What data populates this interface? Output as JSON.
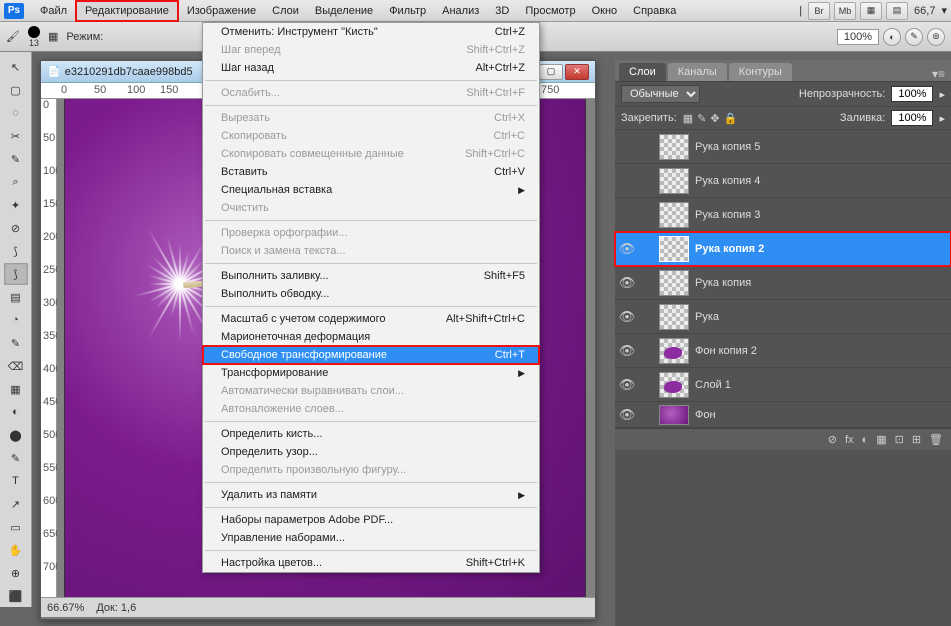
{
  "menubar": {
    "items": [
      "Файл",
      "Редактирование",
      "Изображение",
      "Слои",
      "Выделение",
      "Фильтр",
      "Анализ",
      "3D",
      "Просмотр",
      "Окно",
      "Справка"
    ],
    "highlight_index": 1,
    "right_buttons": [
      "Br",
      "Mb",
      "▦",
      "▤"
    ],
    "zoom_pct": "66,7"
  },
  "optbar": {
    "brush_size": "13",
    "mode_label": "Режим:",
    "zoom": "100%"
  },
  "document": {
    "title": "e3210291db7caae998bd5",
    "ruler_h": [
      "0",
      "50",
      "100",
      "150",
      "750"
    ],
    "ruler_v": [
      "0",
      "50",
      "100",
      "150",
      "200",
      "250",
      "300",
      "350",
      "400",
      "450",
      "500",
      "550",
      "600",
      "650",
      "700"
    ],
    "status_zoom": "66.67%",
    "status_doc": "Док: 1,6"
  },
  "dropdown": {
    "items": [
      {
        "label": "Отменить: Инструмент \"Кисть\"",
        "shortcut": "Ctrl+Z"
      },
      {
        "label": "Шаг вперед",
        "shortcut": "Shift+Ctrl+Z",
        "disabled": true
      },
      {
        "label": "Шаг назад",
        "shortcut": "Alt+Ctrl+Z"
      },
      {
        "sep": true
      },
      {
        "label": "Ослабить...",
        "shortcut": "Shift+Ctrl+F",
        "disabled": true
      },
      {
        "sep": true
      },
      {
        "label": "Вырезать",
        "shortcut": "Ctrl+X",
        "disabled": true
      },
      {
        "label": "Скопировать",
        "shortcut": "Ctrl+C",
        "disabled": true
      },
      {
        "label": "Скопировать совмещенные данные",
        "shortcut": "Shift+Ctrl+C",
        "disabled": true
      },
      {
        "label": "Вставить",
        "shortcut": "Ctrl+V"
      },
      {
        "label": "Специальная вставка",
        "submenu": true
      },
      {
        "label": "Очистить",
        "disabled": true
      },
      {
        "sep": true
      },
      {
        "label": "Проверка орфографии...",
        "disabled": true
      },
      {
        "label": "Поиск и замена текста...",
        "disabled": true
      },
      {
        "sep": true
      },
      {
        "label": "Выполнить заливку...",
        "shortcut": "Shift+F5"
      },
      {
        "label": "Выполнить обводку..."
      },
      {
        "sep": true
      },
      {
        "label": "Масштаб с учетом содержимого",
        "shortcut": "Alt+Shift+Ctrl+C"
      },
      {
        "label": "Марионеточная деформация"
      },
      {
        "label": "Свободное трансформирование",
        "shortcut": "Ctrl+T",
        "hl": true
      },
      {
        "label": "Трансформирование",
        "submenu": true
      },
      {
        "label": "Автоматически выравнивать слои...",
        "disabled": true
      },
      {
        "label": "Автоналожение слоев...",
        "disabled": true
      },
      {
        "sep": true
      },
      {
        "label": "Определить кисть..."
      },
      {
        "label": "Определить узор..."
      },
      {
        "label": "Определить произвольную фигуру...",
        "disabled": true
      },
      {
        "sep": true
      },
      {
        "label": "Удалить из памяти",
        "submenu": true
      },
      {
        "sep": true
      },
      {
        "label": "Наборы параметров Adobe PDF..."
      },
      {
        "label": "Управление наборами..."
      },
      {
        "sep": true
      },
      {
        "label": "Настройка цветов...",
        "shortcut": "Shift+Ctrl+K"
      }
    ]
  },
  "panels": {
    "tabs": [
      "Слои",
      "Каналы",
      "Контуры"
    ],
    "active_tab": 0,
    "blend_mode": "Обычные",
    "opacity_label": "Непрозрачность:",
    "opacity": "100%",
    "lock_label": "Закрепить:",
    "fill_label": "Заливка:",
    "fill": "100%",
    "layers": [
      {
        "name": "Рука копия 5",
        "visible": false,
        "thumb": "checker"
      },
      {
        "name": "Рука копия 4",
        "visible": false,
        "thumb": "checker"
      },
      {
        "name": "Рука копия 3",
        "visible": false,
        "thumb": "checker"
      },
      {
        "name": "Рука копия 2",
        "visible": true,
        "thumb": "checker",
        "selected": true
      },
      {
        "name": "Рука копия",
        "visible": true,
        "thumb": "checker"
      },
      {
        "name": "Рука",
        "visible": true,
        "thumb": "checker"
      },
      {
        "name": "Фон копия 2",
        "visible": true,
        "thumb": "blob"
      },
      {
        "name": "Слой 1",
        "visible": true,
        "thumb": "blob"
      },
      {
        "name": "Фон",
        "visible": true,
        "thumb": "purple",
        "last": true
      }
    ],
    "footer_icons": [
      "⊘",
      "fx",
      "◐",
      "▦",
      "⊡",
      "⊞",
      "🗑"
    ]
  },
  "tools": [
    "↖",
    "▢",
    "◌",
    "✂",
    "✎",
    "⌕",
    "✦",
    "⊘",
    "⟆",
    "⟆",
    "▤",
    "◔",
    "✎",
    "⌫",
    "▦",
    "◐",
    "⬤",
    "✎",
    "T",
    "↗",
    "▭",
    "✋",
    "⊕",
    "⬛"
  ]
}
